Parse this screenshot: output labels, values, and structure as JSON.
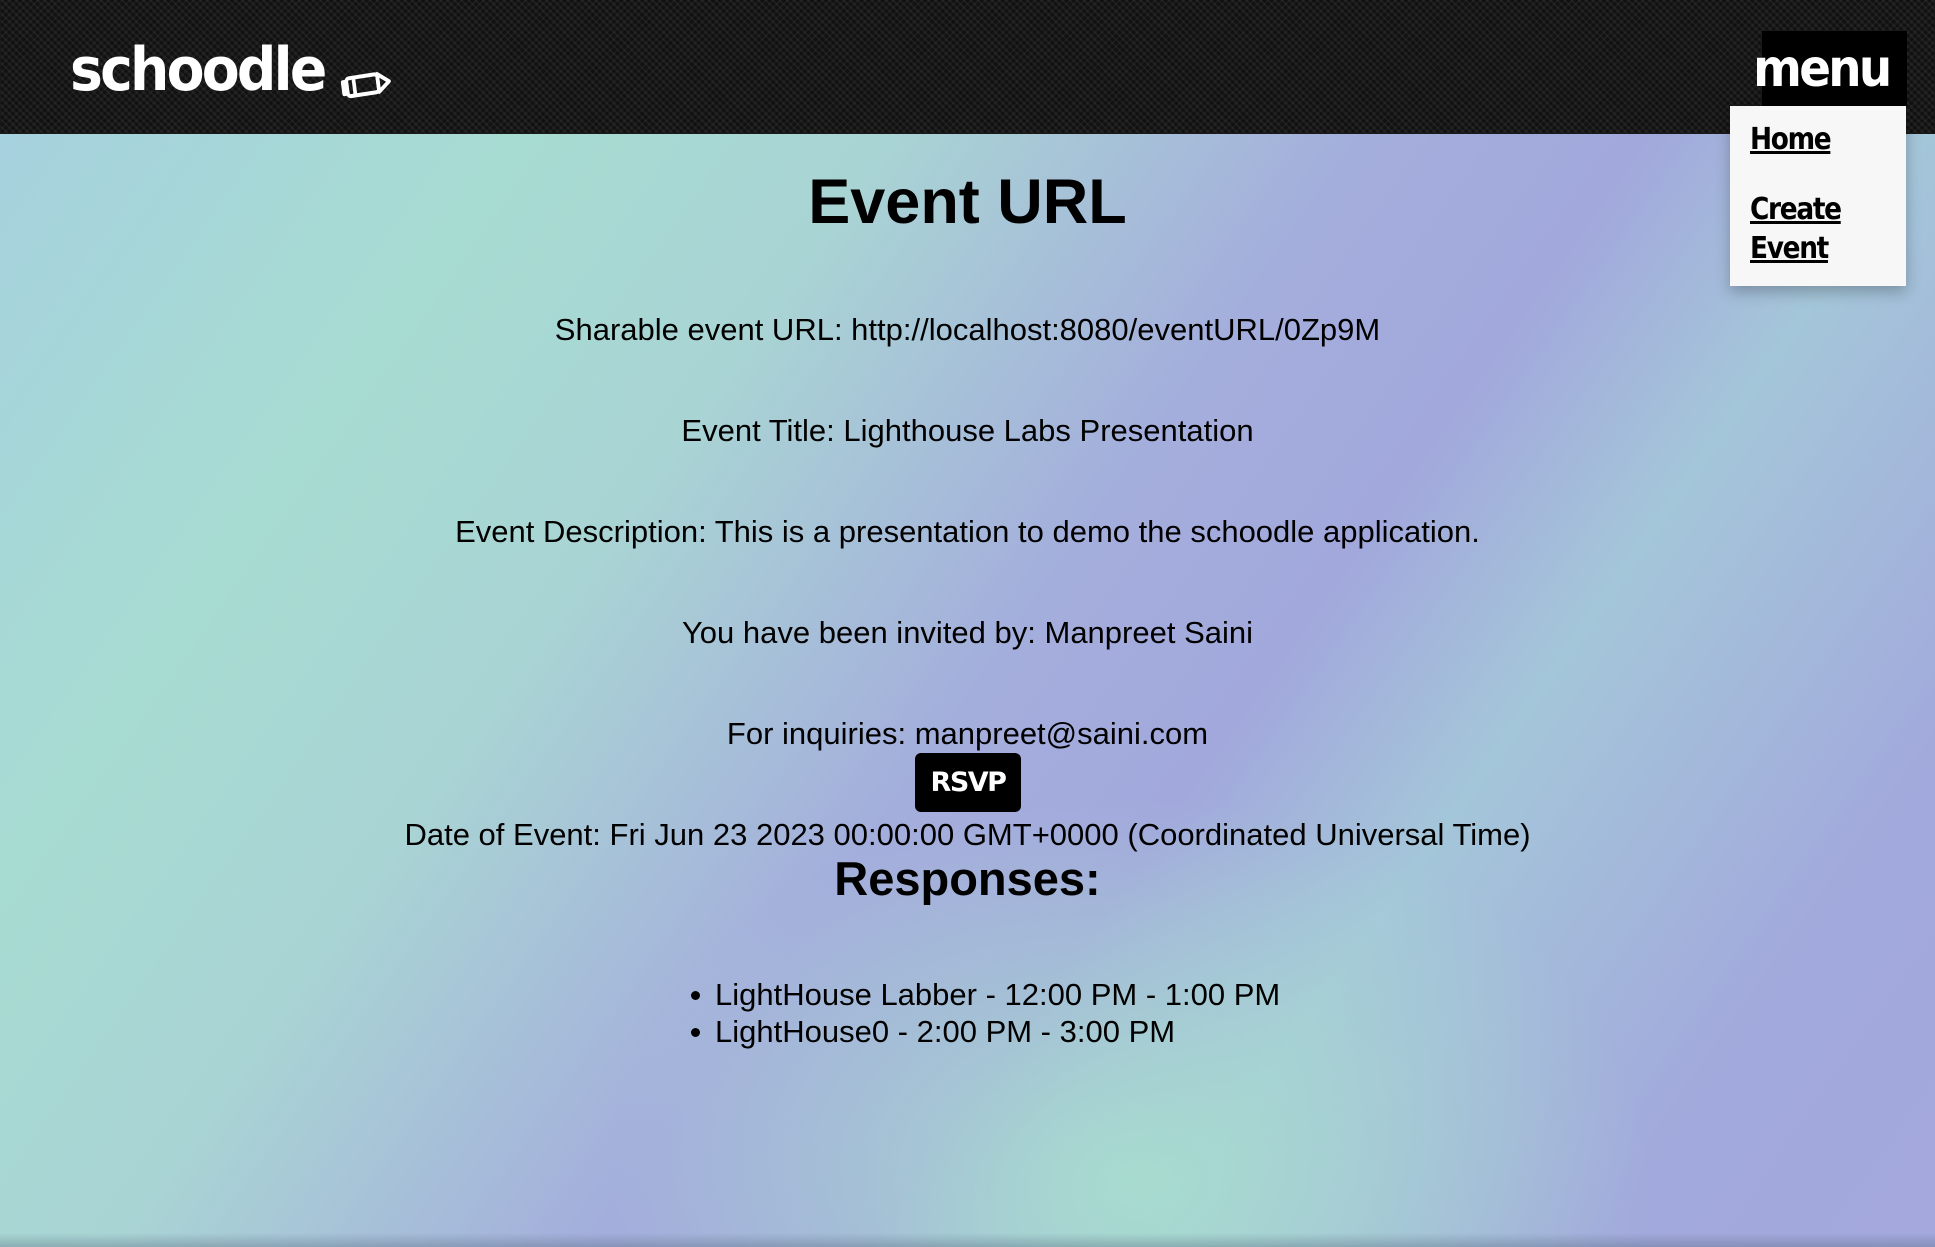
{
  "header": {
    "logo_text": "schoodle",
    "logo_icon": "pencil-icon",
    "menu_label": "menu"
  },
  "menu": {
    "items": [
      {
        "label": "Home"
      },
      {
        "label": "Create Event"
      }
    ]
  },
  "main": {
    "title": "Event URL",
    "url_line": "Sharable event URL: http://localhost:8080/eventURL/0Zp9M",
    "title_line": "Event Title: Lighthouse Labs Presentation",
    "description_line": "Event Description: This is a presentation to demo the schoodle application.",
    "invited_line": "You have been invited by: Manpreet Saini",
    "inquiries_line": "For inquiries: manpreet@saini.com",
    "date_line": "Date of Event: Fri Jun 23 2023 00:00:00 GMT+0000 (Coordinated Universal Time)",
    "rsvp_label": "RSVP",
    "responses_heading": "Responses:",
    "responses": [
      "LightHouse Labber - 12:00 PM - 1:00 PM",
      "LightHouse0 - 2:00 PM - 3:00 PM"
    ]
  },
  "colors": {
    "header_bg": "#111111",
    "button_bg": "#000000",
    "dropdown_bg": "#f7f7f7",
    "gradient_teal": "#a7dcd2",
    "gradient_lavender": "#a2a8dc"
  }
}
